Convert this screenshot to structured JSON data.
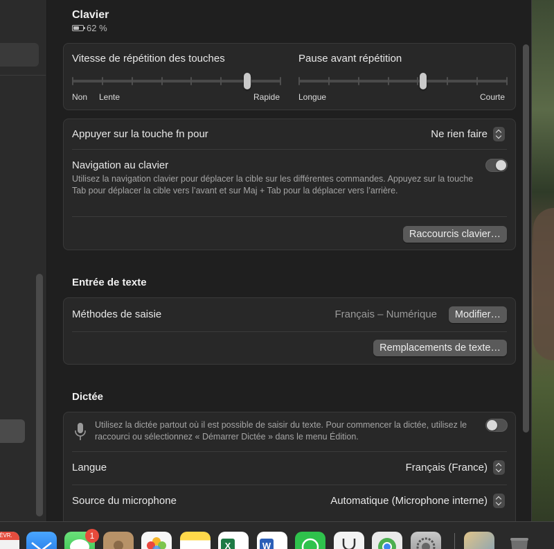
{
  "window": {
    "title": "Clavier",
    "battery": "62 %"
  },
  "sliders": {
    "repeat": {
      "title": "Vitesse de répétition des touches",
      "label_left": "Non",
      "label_left2": "Lente",
      "label_right": "Rapide",
      "level": 0.85
    },
    "delay": {
      "title": "Pause avant répétition",
      "label_left": "Longue",
      "label_right": "Courte",
      "level": 0.6
    }
  },
  "keyboard": {
    "fn_label": "Appuyer sur la touche fn pour",
    "fn_value": "Ne rien faire",
    "nav_label": "Navigation au clavier",
    "nav_desc": "Utilisez la navigation clavier pour déplacer la cible sur les différentes commandes. Appuyez sur la touche Tab pour déplacer la cible vers l’avant et sur Maj + Tab pour la déplacer vers l’arrière.",
    "nav_enabled": true,
    "shortcuts_button": "Raccourcis clavier…"
  },
  "text_input": {
    "section_title": "Entrée de texte",
    "methods_label": "Méthodes de saisie",
    "methods_value": "Français – Numérique",
    "modify_button": "Modifier…",
    "replacements_button": "Remplacements de texte…"
  },
  "dictation": {
    "section_title": "Dictée",
    "desc": "Utilisez la dictée partout où il est possible de saisir du texte. Pour commencer la dictée, utilisez le raccourci ou sélectionnez « Démarrer Dictée » dans le menu Édition.",
    "enabled": false,
    "language_label": "Langue",
    "language_value": "Français (France)",
    "mic_label": "Source du microphone",
    "mic_value": "Automatique (Microphone interne)"
  },
  "dock": {
    "calendar_month": "FÉVR.",
    "messages_badge": "1",
    "icons": [
      "calendar-icon",
      "mail-icon",
      "messages-icon",
      "contacts-icon",
      "photos-icon",
      "notes-icon",
      "excel-icon",
      "word-icon",
      "whatsapp-icon",
      "stethoscope-icon",
      "chrome-icon",
      "system-settings-icon",
      "preview-icon",
      "trash-icon"
    ]
  }
}
